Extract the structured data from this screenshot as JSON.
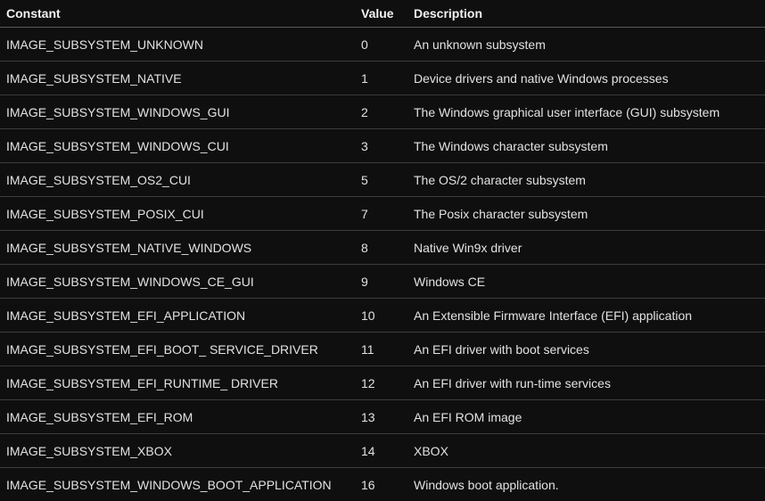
{
  "table": {
    "headers": [
      "Constant",
      "Value",
      "Description"
    ],
    "rows": [
      [
        "IMAGE_SUBSYSTEM_UNKNOWN",
        "0",
        "An unknown subsystem"
      ],
      [
        "IMAGE_SUBSYSTEM_NATIVE",
        "1",
        "Device drivers and native Windows processes"
      ],
      [
        "IMAGE_SUBSYSTEM_WINDOWS_GUI",
        "2",
        "The Windows graphical user interface (GUI) subsystem"
      ],
      [
        "IMAGE_SUBSYSTEM_WINDOWS_CUI",
        "3",
        "The Windows character subsystem"
      ],
      [
        "IMAGE_SUBSYSTEM_OS2_CUI",
        "5",
        "The OS/2 character subsystem"
      ],
      [
        "IMAGE_SUBSYSTEM_POSIX_CUI",
        "7",
        "The Posix character subsystem"
      ],
      [
        "IMAGE_SUBSYSTEM_NATIVE_WINDOWS",
        "8",
        "Native Win9x driver"
      ],
      [
        "IMAGE_SUBSYSTEM_WINDOWS_CE_GUI",
        "9",
        "Windows CE"
      ],
      [
        "IMAGE_SUBSYSTEM_EFI_APPLICATION",
        "10",
        "An Extensible Firmware Interface (EFI) application"
      ],
      [
        "IMAGE_SUBSYSTEM_EFI_BOOT_ SERVICE_DRIVER",
        "11",
        "An EFI driver with boot services"
      ],
      [
        "IMAGE_SUBSYSTEM_EFI_RUNTIME_ DRIVER",
        "12",
        "An EFI driver with run-time services"
      ],
      [
        "IMAGE_SUBSYSTEM_EFI_ROM",
        "13",
        "An EFI ROM image"
      ],
      [
        "IMAGE_SUBSYSTEM_XBOX",
        "14",
        "XBOX"
      ],
      [
        "IMAGE_SUBSYSTEM_WINDOWS_BOOT_APPLICATION",
        "16",
        "Windows boot application."
      ]
    ]
  }
}
